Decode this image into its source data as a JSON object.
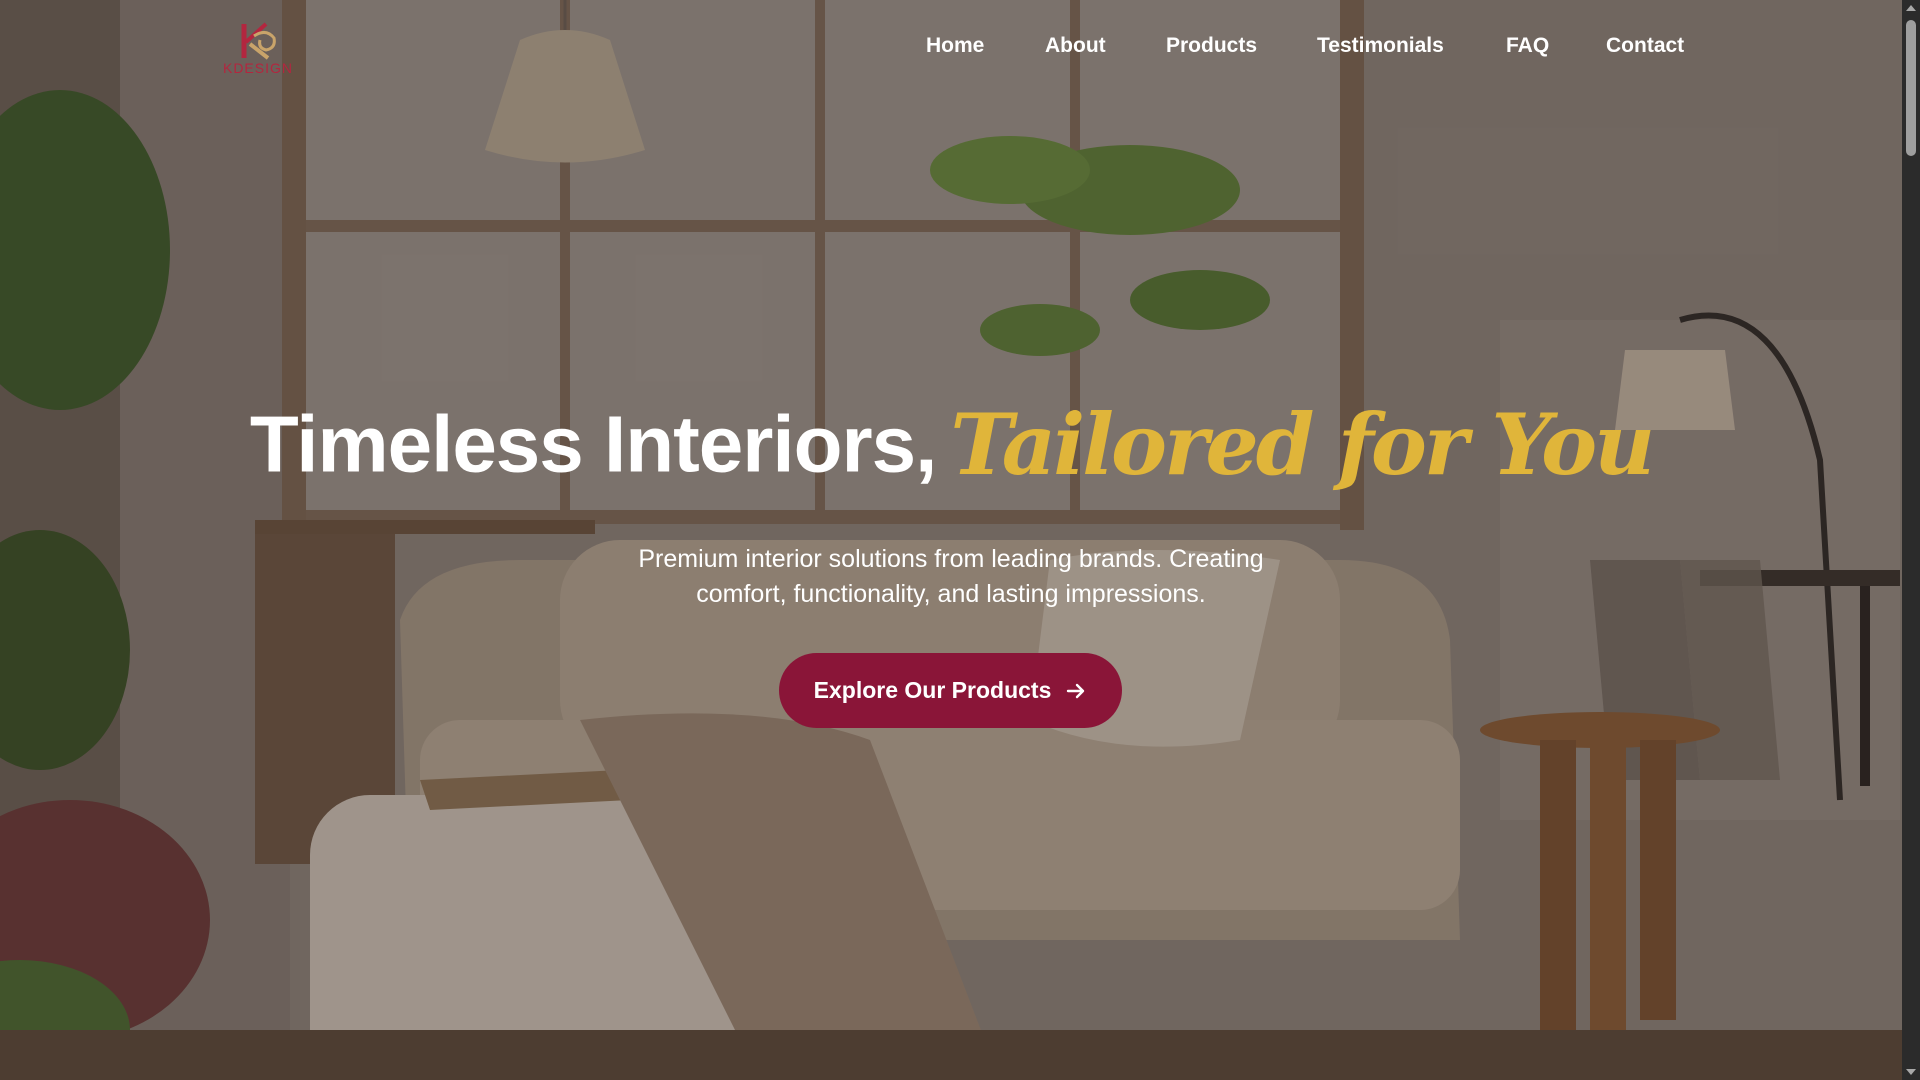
{
  "brand": {
    "logo_text": "KDESIGN"
  },
  "nav": {
    "items": [
      {
        "label": "Home"
      },
      {
        "label": "About"
      },
      {
        "label": "Products"
      },
      {
        "label": "Testimonials"
      },
      {
        "label": "FAQ"
      },
      {
        "label": "Contact"
      }
    ]
  },
  "hero": {
    "headline_plain": "Timeless Interiors,",
    "headline_script": "Tailored for You",
    "subtitle_line1": "Premium interior solutions from leading brands. Creating",
    "subtitle_line2": "comfort, functionality, and lasting impressions.",
    "cta_label": "Explore Our Products",
    "cta_icon": "arrow-right-icon"
  },
  "colors": {
    "accent": "#8a1538",
    "script_gold": "#e0b53a",
    "logo_red": "#b3263f",
    "text": "#ffffff"
  }
}
